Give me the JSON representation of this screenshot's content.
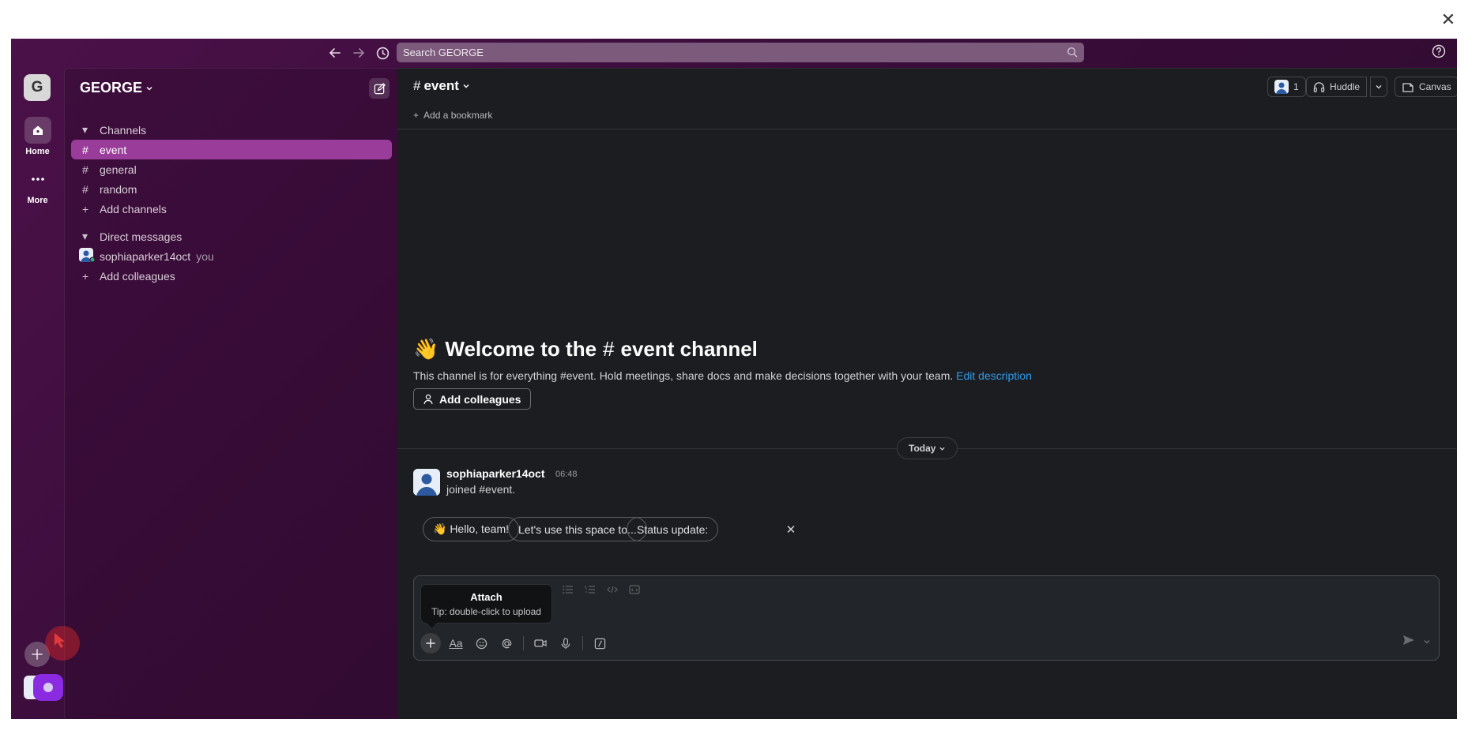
{
  "window": {
    "close_glyph": "✕"
  },
  "topbar": {
    "search_placeholder": "Search GEORGE",
    "icons": [
      "arrow-left-icon",
      "arrow-right-icon",
      "history-icon",
      "search-icon",
      "help-icon"
    ]
  },
  "rail": {
    "workspace_initial": "G",
    "items": [
      {
        "label": "Home",
        "icon": "home-icon"
      },
      {
        "label": "More",
        "icon": "more-icon"
      }
    ]
  },
  "sidebar": {
    "workspace_name": "GEORGE",
    "channels_header": "Channels",
    "channels": [
      {
        "name": "event",
        "active": true
      },
      {
        "name": "general",
        "active": false
      },
      {
        "name": "random",
        "active": false
      }
    ],
    "add_channels": "Add channels",
    "dm_header": "Direct messages",
    "dm_user": "sophiaparker14oct",
    "dm_you": "you",
    "add_colleagues": "Add colleagues"
  },
  "header": {
    "channel": "event",
    "add_bookmark": "Add a bookmark",
    "member_count": "1",
    "huddle": "Huddle",
    "canvas": "Canvas"
  },
  "welcome": {
    "emoji": "👋",
    "title_prefix": "Welcome to the",
    "title_channel": "event channel",
    "description": "This channel is for everything #event. Hold meetings, share docs and make decisions together with your team.",
    "edit_link": "Edit description",
    "add_colleagues_button": "Add colleagues"
  },
  "divider": {
    "label": "Today"
  },
  "message": {
    "author": "sophiaparker14oct",
    "time": "06:48",
    "text": "joined #event."
  },
  "suggestions": {
    "chips": [
      "👋 Hello, team!",
      "Let's use this space to...",
      "Status update:"
    ],
    "close": "✕"
  },
  "tooltip": {
    "title": "Attach",
    "tip": "Tip: double-click to upload"
  },
  "composer": {
    "format_label": "Aa",
    "colors": {
      "accent": "#9a3c9a",
      "link": "#2f9bea",
      "bg": "#1b1d21"
    }
  }
}
